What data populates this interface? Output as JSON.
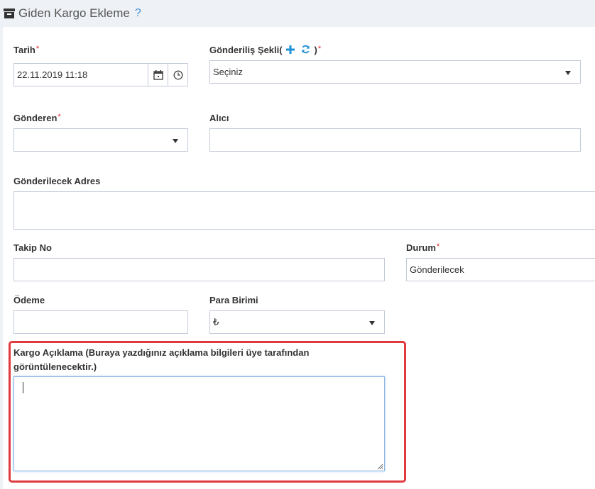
{
  "header": {
    "title": "Giden Kargo Ekleme",
    "help": "?"
  },
  "fields": {
    "tarih": {
      "label": "Tarih",
      "required": "*",
      "value": "22.11.2019 11:18"
    },
    "gonderilis": {
      "label": "Gönderiliş Şekli(",
      "label_close": ")",
      "required": "*",
      "value": "Seçiniz"
    },
    "gonderen": {
      "label": "Gönderen",
      "required": "*",
      "value": ""
    },
    "alici": {
      "label": "Alıcı",
      "value": ""
    },
    "adres": {
      "label": "Gönderilecek Adres",
      "value": ""
    },
    "takip": {
      "label": "Takip No",
      "value": ""
    },
    "durum": {
      "label": "Durum",
      "required": "*",
      "value": "Gönderilecek"
    },
    "odeme": {
      "label": "Ödeme",
      "value": ""
    },
    "para": {
      "label": "Para Birimi",
      "value": "₺"
    },
    "aciklama": {
      "label": "Kargo Açıklama (Buraya yazdığınız açıklama bilgileri üye tarafından görüntülenecektir.)",
      "value": ""
    }
  },
  "colors": {
    "accent": "#3b8fd6",
    "required": "#e02222",
    "highlight": "#e0393e",
    "add_icon": "#1e90d6"
  },
  "icons": [
    "archive-box-icon",
    "help-icon",
    "plus-icon",
    "refresh-icon",
    "calendar-icon",
    "clock-icon",
    "chevron-down-icon"
  ]
}
